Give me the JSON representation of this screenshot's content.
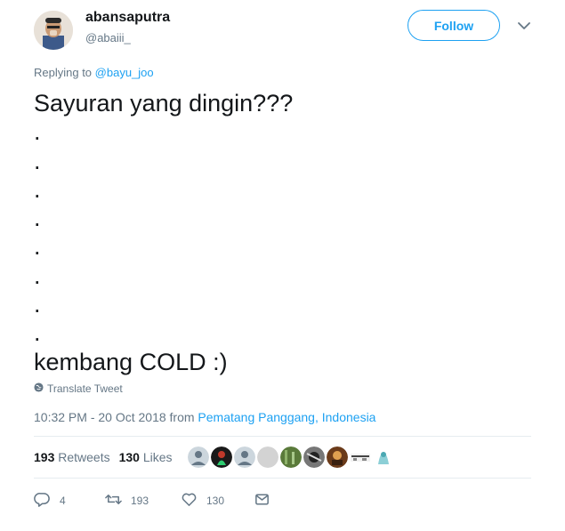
{
  "tweet": {
    "display_name": "abansaputra",
    "handle": "@abaiii_",
    "follow_label": "Follow",
    "replying_prefix": "Replying to",
    "replying_to": "@bayu_joo",
    "text": "Sayuran yang dingin???\n.\n.\n.\n.\n.\n.\n.\n.\nkembang COLD :)",
    "translate_label": "Translate Tweet",
    "timestamp": "10:32 PM - 20 Oct 2018 from",
    "location": "Pematang Panggang, Indonesia"
  },
  "stats": {
    "retweets_count": "193",
    "retweets_label": "Retweets",
    "likes_count": "130",
    "likes_label": "Likes"
  },
  "actions": {
    "reply_count": "4",
    "retweet_count": "193",
    "like_count": "130"
  },
  "colors": {
    "accent": "#1da1f2",
    "muted": "#657786",
    "text": "#14171a",
    "divider": "#e6ecf0"
  },
  "icons": {
    "caret": "chevron-down-icon",
    "globe": "globe-icon",
    "reply": "reply-icon",
    "retweet": "retweet-icon",
    "like": "heart-icon",
    "dm": "envelope-icon"
  }
}
